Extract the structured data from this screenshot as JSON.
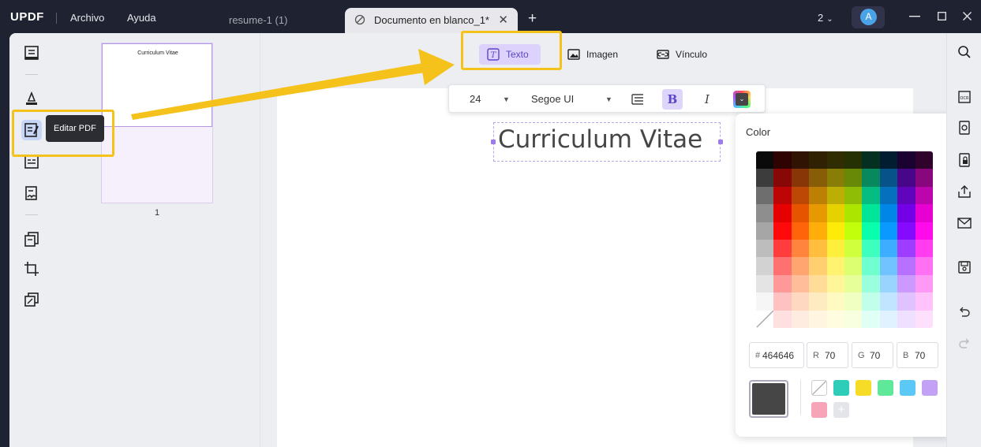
{
  "titlebar": {
    "logo": "UPDF",
    "menu": [
      "Archivo",
      "Ayuda"
    ],
    "tabs": [
      {
        "label": "resume-1 (1)",
        "active": false
      },
      {
        "label": "Documento en blanco_1*",
        "active": true
      }
    ],
    "new_tab": "+",
    "close_tab": "✕",
    "page_count": "2",
    "avatar_letter": "A",
    "window_controls": [
      "minimize",
      "maximize",
      "close"
    ]
  },
  "left_sidebar": {
    "icons": [
      "reader-icon",
      "comment-icon",
      "edit-pdf-icon",
      "form-icon",
      "sign-icon",
      "organize-pages-icon",
      "crop-icon",
      "layers-icon"
    ],
    "active": "edit-pdf-icon",
    "tooltip": "Editar PDF"
  },
  "thumbnails": {
    "pages": [
      {
        "number": "1",
        "title": "Curriculum Vitae"
      }
    ]
  },
  "edit_toolbar": {
    "tools": [
      {
        "label": "Texto",
        "icon": "text-box-icon",
        "active": true
      },
      {
        "label": "Imagen",
        "icon": "image-icon",
        "active": false
      },
      {
        "label": "Vínculo",
        "icon": "link-icon",
        "active": false
      }
    ]
  },
  "format_bar": {
    "font_size": "24",
    "font_family": "Segoe UI",
    "bold": "B",
    "italic": "I",
    "current_color": "#464646"
  },
  "document": {
    "text": "Curriculum Vitae"
  },
  "color_picker": {
    "title": "Color",
    "hex_label": "#",
    "hex": "464646",
    "r_label": "R",
    "r": "70",
    "g_label": "G",
    "g": "70",
    "b_label": "B",
    "b": "70",
    "current": "#464646",
    "presets": [
      "none",
      "#2ecdb9",
      "#f7dc27",
      "#5fe89a",
      "#5cc8f5",
      "#c3a2f5",
      "#f7a3b8"
    ],
    "add_label": "+"
  },
  "right_sidebar": {
    "icons": [
      "search-icon",
      "ocr-icon",
      "convert-icon",
      "protect-icon",
      "share-icon",
      "mail-icon",
      "save-icon",
      "undo-icon",
      "redo-icon"
    ]
  }
}
